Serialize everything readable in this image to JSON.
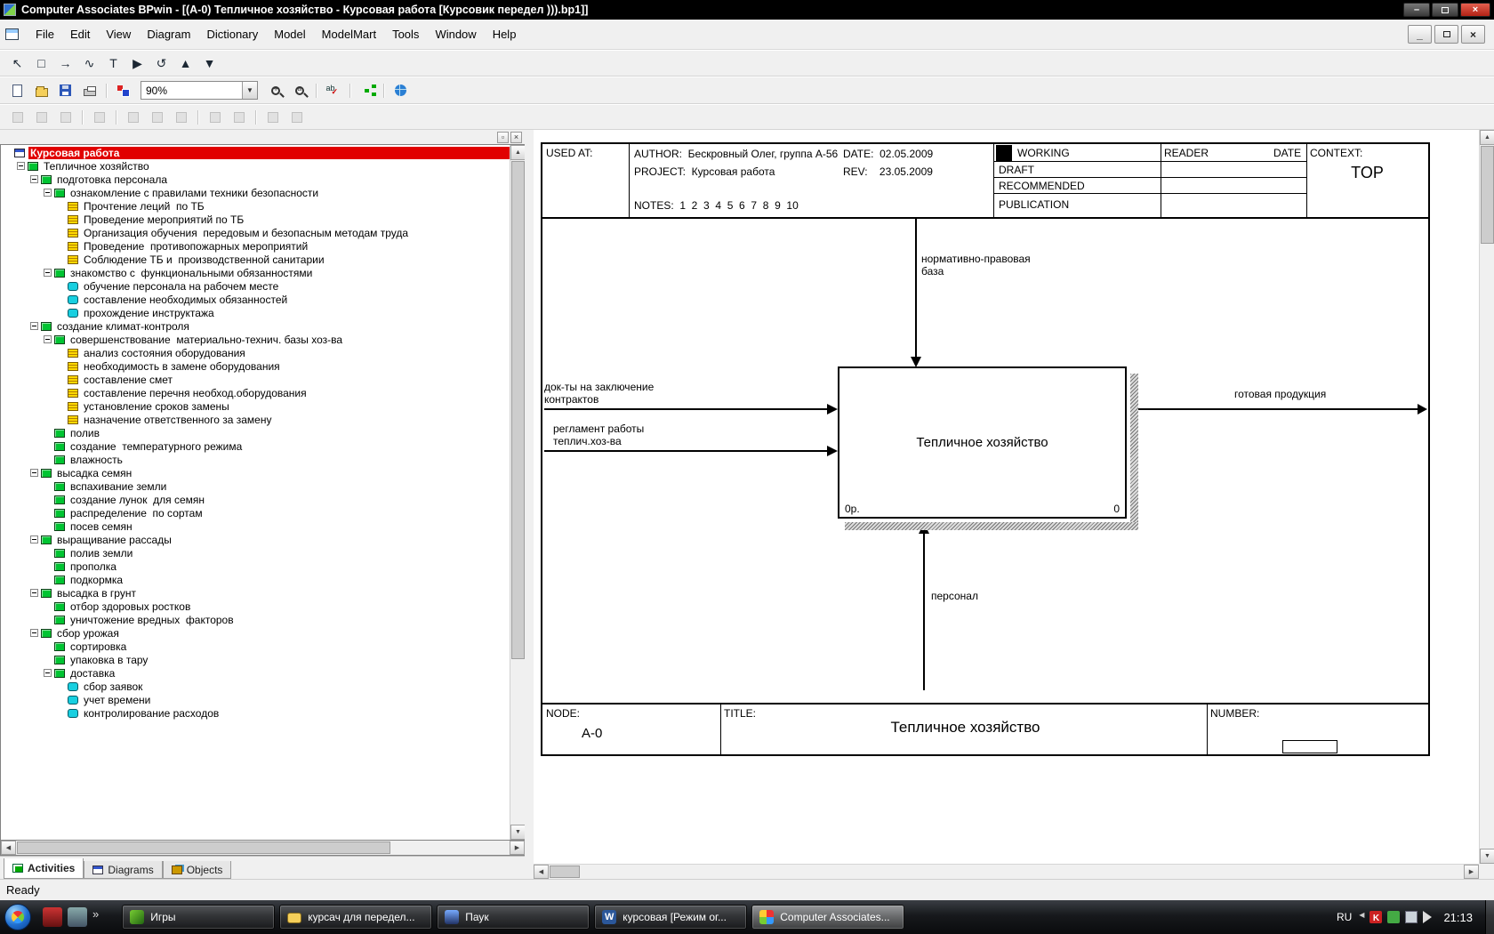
{
  "titlebar": {
    "title": "Computer Associates BPwin - [(А-0) Тепличное хозяйство - Курсовая работа  [Курсовик передел ))).bp1]]"
  },
  "menubar": {
    "items": [
      "File",
      "Edit",
      "View",
      "Diagram",
      "Dictionary",
      "Model",
      "ModelMart",
      "Tools",
      "Window",
      "Help"
    ]
  },
  "toolbars": {
    "draw": [
      {
        "name": "pointer-tool",
        "glyph": "↖"
      },
      {
        "name": "activity-box-tool",
        "glyph": "□"
      },
      {
        "name": "arrow-tool",
        "glyph": "→"
      },
      {
        "name": "squiggle-tool",
        "glyph": "∿"
      },
      {
        "name": "text-tool",
        "glyph": "T"
      },
      {
        "name": "diagram-dictionary-tool",
        "glyph": "▶"
      },
      {
        "name": "go-to-sibling-diagram-tool",
        "glyph": "↺"
      },
      {
        "name": "go-to-parent-diagram-tool",
        "glyph": "▲"
      },
      {
        "name": "go-to-child-diagram-tool",
        "glyph": "▼"
      }
    ],
    "standard_left": [
      [
        {
          "name": "new-model-button",
          "icon": "page"
        },
        {
          "name": "open-model-button",
          "icon": "folder"
        },
        {
          "name": "save-model-button",
          "icon": "floppy"
        },
        {
          "name": "print-button",
          "icon": "printer"
        }
      ],
      [
        {
          "name": "report-button",
          "icon": "colors"
        }
      ]
    ],
    "zoom_value": "90%",
    "standard_right": [
      [
        {
          "name": "zoom-in-button",
          "icon": "zoomin"
        },
        {
          "name": "zoom-custom-button",
          "icon": "zoomdoc"
        }
      ],
      [
        {
          "name": "spell-check-button",
          "icon": "spell"
        }
      ],
      [
        {
          "name": "model-explorer-button",
          "icon": "tree"
        }
      ],
      [
        {
          "name": "web-publish-button",
          "icon": "globe"
        }
      ]
    ],
    "modelmart": [
      [
        "mart-connect-button",
        "mart-disconnect-button",
        "mart-open-button"
      ],
      [
        "mart-save-button"
      ],
      [
        "mart-lock-button",
        "mart-users-button",
        "mart-library-button"
      ],
      [
        "mart-version-button",
        "mart-merge-button"
      ],
      [
        "mart-options-button",
        "mart-refresh-button"
      ]
    ]
  },
  "tree": {
    "items": [
      {
        "label": "Курсовая работа",
        "depth": 0,
        "icon": "model",
        "expand": false,
        "selected": true
      },
      {
        "label": "Тепличное хозяйство",
        "depth": 1,
        "icon": "activity",
        "expand": true
      },
      {
        "label": "подготовка персонала",
        "depth": 2,
        "icon": "activity",
        "expand": true
      },
      {
        "label": "ознакомление с правилами техники безопасности",
        "depth": 3,
        "icon": "activity",
        "expand": true
      },
      {
        "label": "Прочтение леций  по ТБ",
        "depth": 4,
        "icon": "dfd",
        "expand": false
      },
      {
        "label": "Проведение мероприятий по ТБ",
        "depth": 4,
        "icon": "dfd",
        "expand": false
      },
      {
        "label": "Организация обучения  передовым и безопасным методам труда",
        "depth": 4,
        "icon": "dfd",
        "expand": false
      },
      {
        "label": "Проведение  противопожарных мероприятий",
        "depth": 4,
        "icon": "dfd",
        "expand": false
      },
      {
        "label": "Соблюдение ТБ и  производственной санитарии",
        "depth": 4,
        "icon": "dfd",
        "expand": false
      },
      {
        "label": "знакомство с  функциональными обязанностями",
        "depth": 3,
        "icon": "activity",
        "expand": true
      },
      {
        "label": "обучение персонала на рабочем месте",
        "depth": 4,
        "icon": "idef3",
        "expand": false
      },
      {
        "label": "составление необходимых обязанностей",
        "depth": 4,
        "icon": "idef3",
        "expand": false
      },
      {
        "label": "прохождение инструктажа",
        "depth": 4,
        "icon": "idef3",
        "expand": false
      },
      {
        "label": "создание климат-контроля",
        "depth": 2,
        "icon": "activity",
        "expand": true
      },
      {
        "label": "совершенствование  материально-технич. базы хоз-ва",
        "depth": 3,
        "icon": "activity",
        "expand": true
      },
      {
        "label": "анализ состояния оборудования",
        "depth": 4,
        "icon": "dfd",
        "expand": false
      },
      {
        "label": "необходимость в замене оборудования",
        "depth": 4,
        "icon": "dfd",
        "expand": false
      },
      {
        "label": "составление смет",
        "depth": 4,
        "icon": "dfd",
        "expand": false
      },
      {
        "label": "составление перечня необход.оборудования",
        "depth": 4,
        "icon": "dfd",
        "expand": false
      },
      {
        "label": "установление сроков замены",
        "depth": 4,
        "icon": "dfd",
        "expand": false
      },
      {
        "label": "назначение ответственного за замену",
        "depth": 4,
        "icon": "dfd",
        "expand": false
      },
      {
        "label": "полив",
        "depth": 3,
        "icon": "activity",
        "expand": false
      },
      {
        "label": "создание  температурного режима",
        "depth": 3,
        "icon": "activity",
        "expand": false
      },
      {
        "label": "влажность",
        "depth": 3,
        "icon": "activity",
        "expand": false
      },
      {
        "label": "высадка семян",
        "depth": 2,
        "icon": "activity",
        "expand": true
      },
      {
        "label": "вспахивание земли",
        "depth": 3,
        "icon": "activity",
        "expand": false
      },
      {
        "label": "создание лунок  для семян",
        "depth": 3,
        "icon": "activity",
        "expand": false
      },
      {
        "label": "распределение  по сортам",
        "depth": 3,
        "icon": "activity",
        "expand": false
      },
      {
        "label": "посев семян",
        "depth": 3,
        "icon": "activity",
        "expand": false
      },
      {
        "label": "выращивание рассады",
        "depth": 2,
        "icon": "activity",
        "expand": true
      },
      {
        "label": "полив земли",
        "depth": 3,
        "icon": "activity",
        "expand": false
      },
      {
        "label": "прополка",
        "depth": 3,
        "icon": "activity",
        "expand": false
      },
      {
        "label": "подкормка",
        "depth": 3,
        "icon": "activity",
        "expand": false
      },
      {
        "label": "высадка в грунт",
        "depth": 2,
        "icon": "activity",
        "expand": true
      },
      {
        "label": "отбор здоровых ростков",
        "depth": 3,
        "icon": "activity",
        "expand": false
      },
      {
        "label": "уничтожение вредных  факторов",
        "depth": 3,
        "icon": "activity",
        "expand": false
      },
      {
        "label": "сбор урожая",
        "depth": 2,
        "icon": "activity",
        "expand": true
      },
      {
        "label": "сортировка",
        "depth": 3,
        "icon": "activity",
        "expand": false
      },
      {
        "label": "упаковка в тару",
        "depth": 3,
        "icon": "activity",
        "expand": false
      },
      {
        "label": "доставка",
        "depth": 3,
        "icon": "activity",
        "expand": true
      },
      {
        "label": "сбор заявок",
        "depth": 4,
        "icon": "idef3",
        "expand": false
      },
      {
        "label": "учет времени",
        "depth": 4,
        "icon": "idef3",
        "expand": false
      },
      {
        "label": "контролирование расходов",
        "depth": 4,
        "icon": "idef3",
        "expand": false
      }
    ]
  },
  "tabs": [
    {
      "label": "Activities",
      "icon": "activities",
      "active": true
    },
    {
      "label": "Diagrams",
      "icon": "diagrams",
      "active": false
    },
    {
      "label": "Objects",
      "icon": "objects",
      "active": false
    }
  ],
  "diagram": {
    "kit": {
      "used_at_label": "USED AT:",
      "author_line": "AUTHOR:  Бескровный Олег, группа А-56",
      "project_line": "PROJECT:  Курсовая работа",
      "notes_line": "NOTES:  1  2  3  4  5  6  7  8  9  10",
      "date_line": "DATE:  02.05.2009",
      "rev_line": "REV:    23.05.2009",
      "status_working": "WORKING",
      "status_draft": "DRAFT",
      "status_recommended": "RECOMMENDED",
      "status_publication": "PUBLICATION",
      "reader_label": "READER",
      "reader_date_label": "DATE",
      "context_label": "CONTEXT:",
      "context_value": "TOP"
    },
    "box": {
      "label": "Тепличное хозяйство",
      "cost": "0р.",
      "number": "0"
    },
    "arrows": {
      "control": "нормативно-правовая\nбаза",
      "input1": "док-ты на заключение\nконтрактов",
      "input2": "регламент работы\nтеплич.хоз-ва",
      "output": "готовая продукция",
      "mechanism": "персонал"
    },
    "footer": {
      "node_label": "NODE:",
      "node_value": "А-0",
      "title_label": "TITLE:",
      "title_value": "Тепличное хозяйство",
      "number_label": "NUMBER:"
    }
  },
  "status": {
    "ready": "Ready"
  },
  "taskbar": {
    "quicklaunch_chevron": "»",
    "buttons": [
      {
        "label": "Игры",
        "icon": "games",
        "active": false
      },
      {
        "label": "курсач для передел...",
        "icon": "folder",
        "active": false
      },
      {
        "label": "Паук",
        "icon": "spider",
        "active": false
      },
      {
        "label": "курсовая [Режим ог...",
        "icon": "word",
        "active": false
      },
      {
        "label": "Computer Associates...",
        "icon": "bpwin",
        "active": true
      }
    ],
    "tray": {
      "lang": "RU",
      "icons": [
        "chev",
        "red",
        "green",
        "mon",
        "vol"
      ],
      "clock": "21:13"
    }
  }
}
